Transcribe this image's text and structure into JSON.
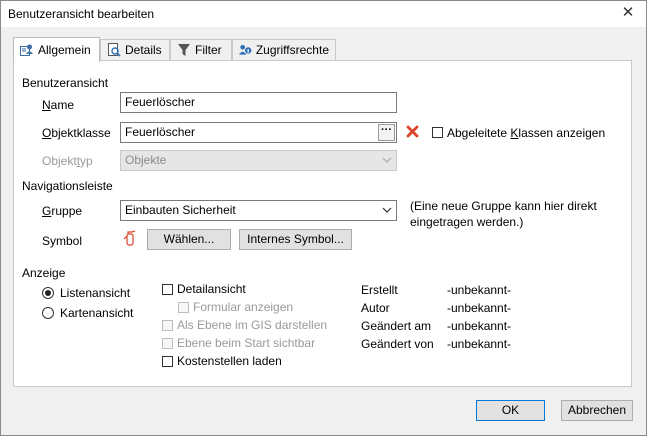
{
  "window": {
    "title": "Benutzeransicht bearbeiten"
  },
  "tabs": [
    {
      "label": "Allgemein",
      "icon": "user-view-icon",
      "active": true
    },
    {
      "label": "Details",
      "icon": "details-search-icon"
    },
    {
      "label": "Filter",
      "icon": "filter-funnel-icon"
    },
    {
      "label": "Zugriffsrechte",
      "icon": "users-lock-icon"
    }
  ],
  "benutzeransicht": {
    "heading": "Benutzeransicht",
    "name_label": "Name",
    "name_value": "Feuerlöscher",
    "objektklasse_label": "Objektklasse",
    "objektklasse_value": "Feuerlöscher",
    "browse_button": "···",
    "abgeleitete_label": "Abgeleitete Klassen anzeigen",
    "objekttyp_label": "Objekttyp",
    "objekttyp_value": "Objekte"
  },
  "navigation": {
    "heading": "Navigationsleiste",
    "gruppe_label": "Gruppe",
    "gruppe_value": "Einbauten Sicherheit",
    "hint": "(Eine neue Gruppe kann hier direkt eingetragen werden.)",
    "symbol_label": "Symbol",
    "waehlen_button": "Wählen...",
    "internes_button": "Internes Symbol..."
  },
  "anzeige": {
    "heading": "Anzeige",
    "radios": [
      {
        "label": "Listenansicht",
        "checked": true
      },
      {
        "label": "Kartenansicht",
        "checked": false
      }
    ],
    "checkboxes": {
      "detailansicht": "Detailansicht",
      "formular": "Formular anzeigen",
      "gis": "Als Ebene im GIS darstellen",
      "start": "Ebene beim Start sichtbar",
      "kosten": "Kostenstellen laden"
    },
    "meta": [
      {
        "key": "Erstellt",
        "value": "-unbekannt-"
      },
      {
        "key": "Autor",
        "value": "-unbekannt-"
      },
      {
        "key": "Geändert am",
        "value": "-unbekannt-"
      },
      {
        "key": "Geändert von",
        "value": "-unbekannt-"
      }
    ]
  },
  "footer": {
    "ok": "OK",
    "cancel": "Abbrechen"
  },
  "colors": {
    "accent": "#0078d7",
    "clear_red": "#d9442a"
  }
}
